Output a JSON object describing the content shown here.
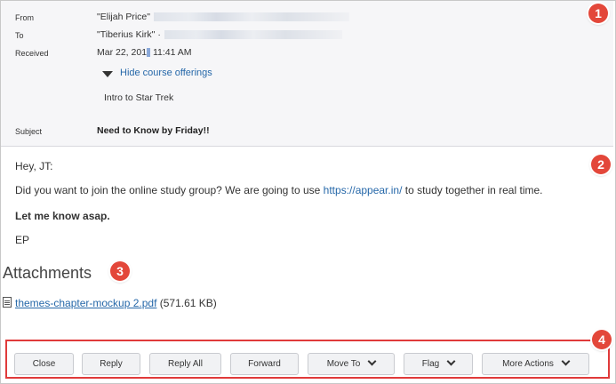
{
  "header": {
    "from_label": "From",
    "from_value": "\"Elijah Price\"",
    "to_label": "To",
    "to_value": "\"Tiberius Kirk\" ·",
    "received_label": "Received",
    "received_value": "Mar 22, 201",
    "received_time": " 11:41 AM",
    "hide_offerings": "Hide course offerings",
    "course": "Intro to Star Trek",
    "subject_label": "Subject",
    "subject_value": "Need to Know by Friday!!"
  },
  "body": {
    "greeting": "Hey, JT:",
    "line1_before": "Did you want to join the online study group? We are going to use ",
    "line1_link": "https://appear.in/",
    "line1_after": " to study together in real time.",
    "line2": "Let me know asap.",
    "signature": "EP"
  },
  "attachments": {
    "title": "Attachments",
    "file_name": "themes-chapter-mockup 2.pdf",
    "file_size": "(571.61 KB)"
  },
  "toolbar": {
    "close": "Close",
    "reply": "Reply",
    "reply_all": "Reply All",
    "forward": "Forward",
    "move_to": "Move To",
    "flag": "Flag",
    "more_actions": "More Actions"
  },
  "callouts": [
    "1",
    "2",
    "3",
    "4"
  ],
  "colors": {
    "callout": "#e3473a",
    "link": "#2668a9",
    "highlight_box": "#e03a3a"
  }
}
